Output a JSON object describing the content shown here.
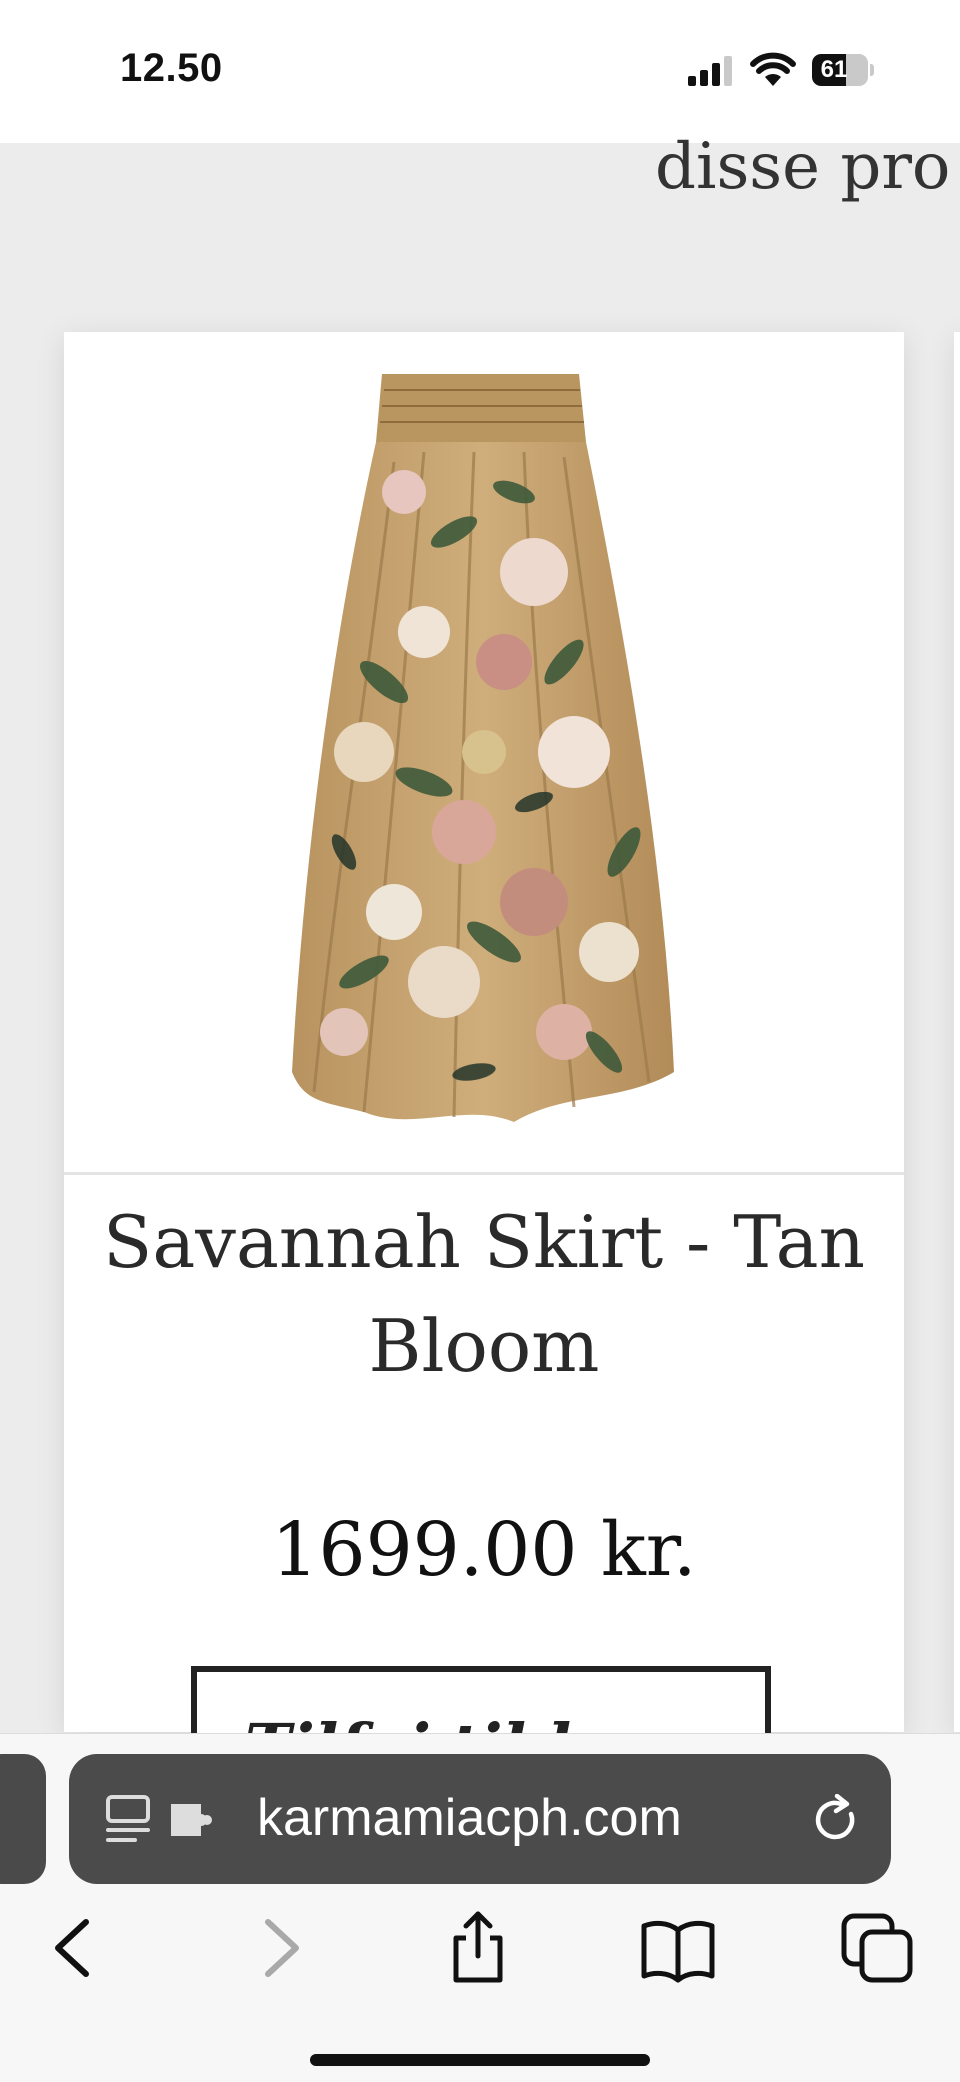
{
  "status_bar": {
    "time": "12.50",
    "battery_level": "61",
    "icons": [
      "signal-icon",
      "wifi-icon",
      "battery-icon"
    ]
  },
  "page": {
    "heading_partial": "disse pro"
  },
  "product": {
    "image": "floral-maxi-skirt-image",
    "name": "Savannah Skirt - Tan Bloom",
    "price": "1699.00 kr.",
    "add_button_label": "Tilføj til kurv"
  },
  "browser": {
    "url": "karmamiacph.com",
    "url_bar_icons": [
      "reader-icon",
      "extension-icon",
      "reload-icon"
    ],
    "toolbar_icons": [
      "back-arrow-icon",
      "forward-arrow-icon",
      "share-icon",
      "bookmarks-icon",
      "tabs-icon"
    ]
  },
  "colors": {
    "page_background": "#ececec",
    "url_bar": "#4b4b4b",
    "text": "#2a2a2a"
  }
}
